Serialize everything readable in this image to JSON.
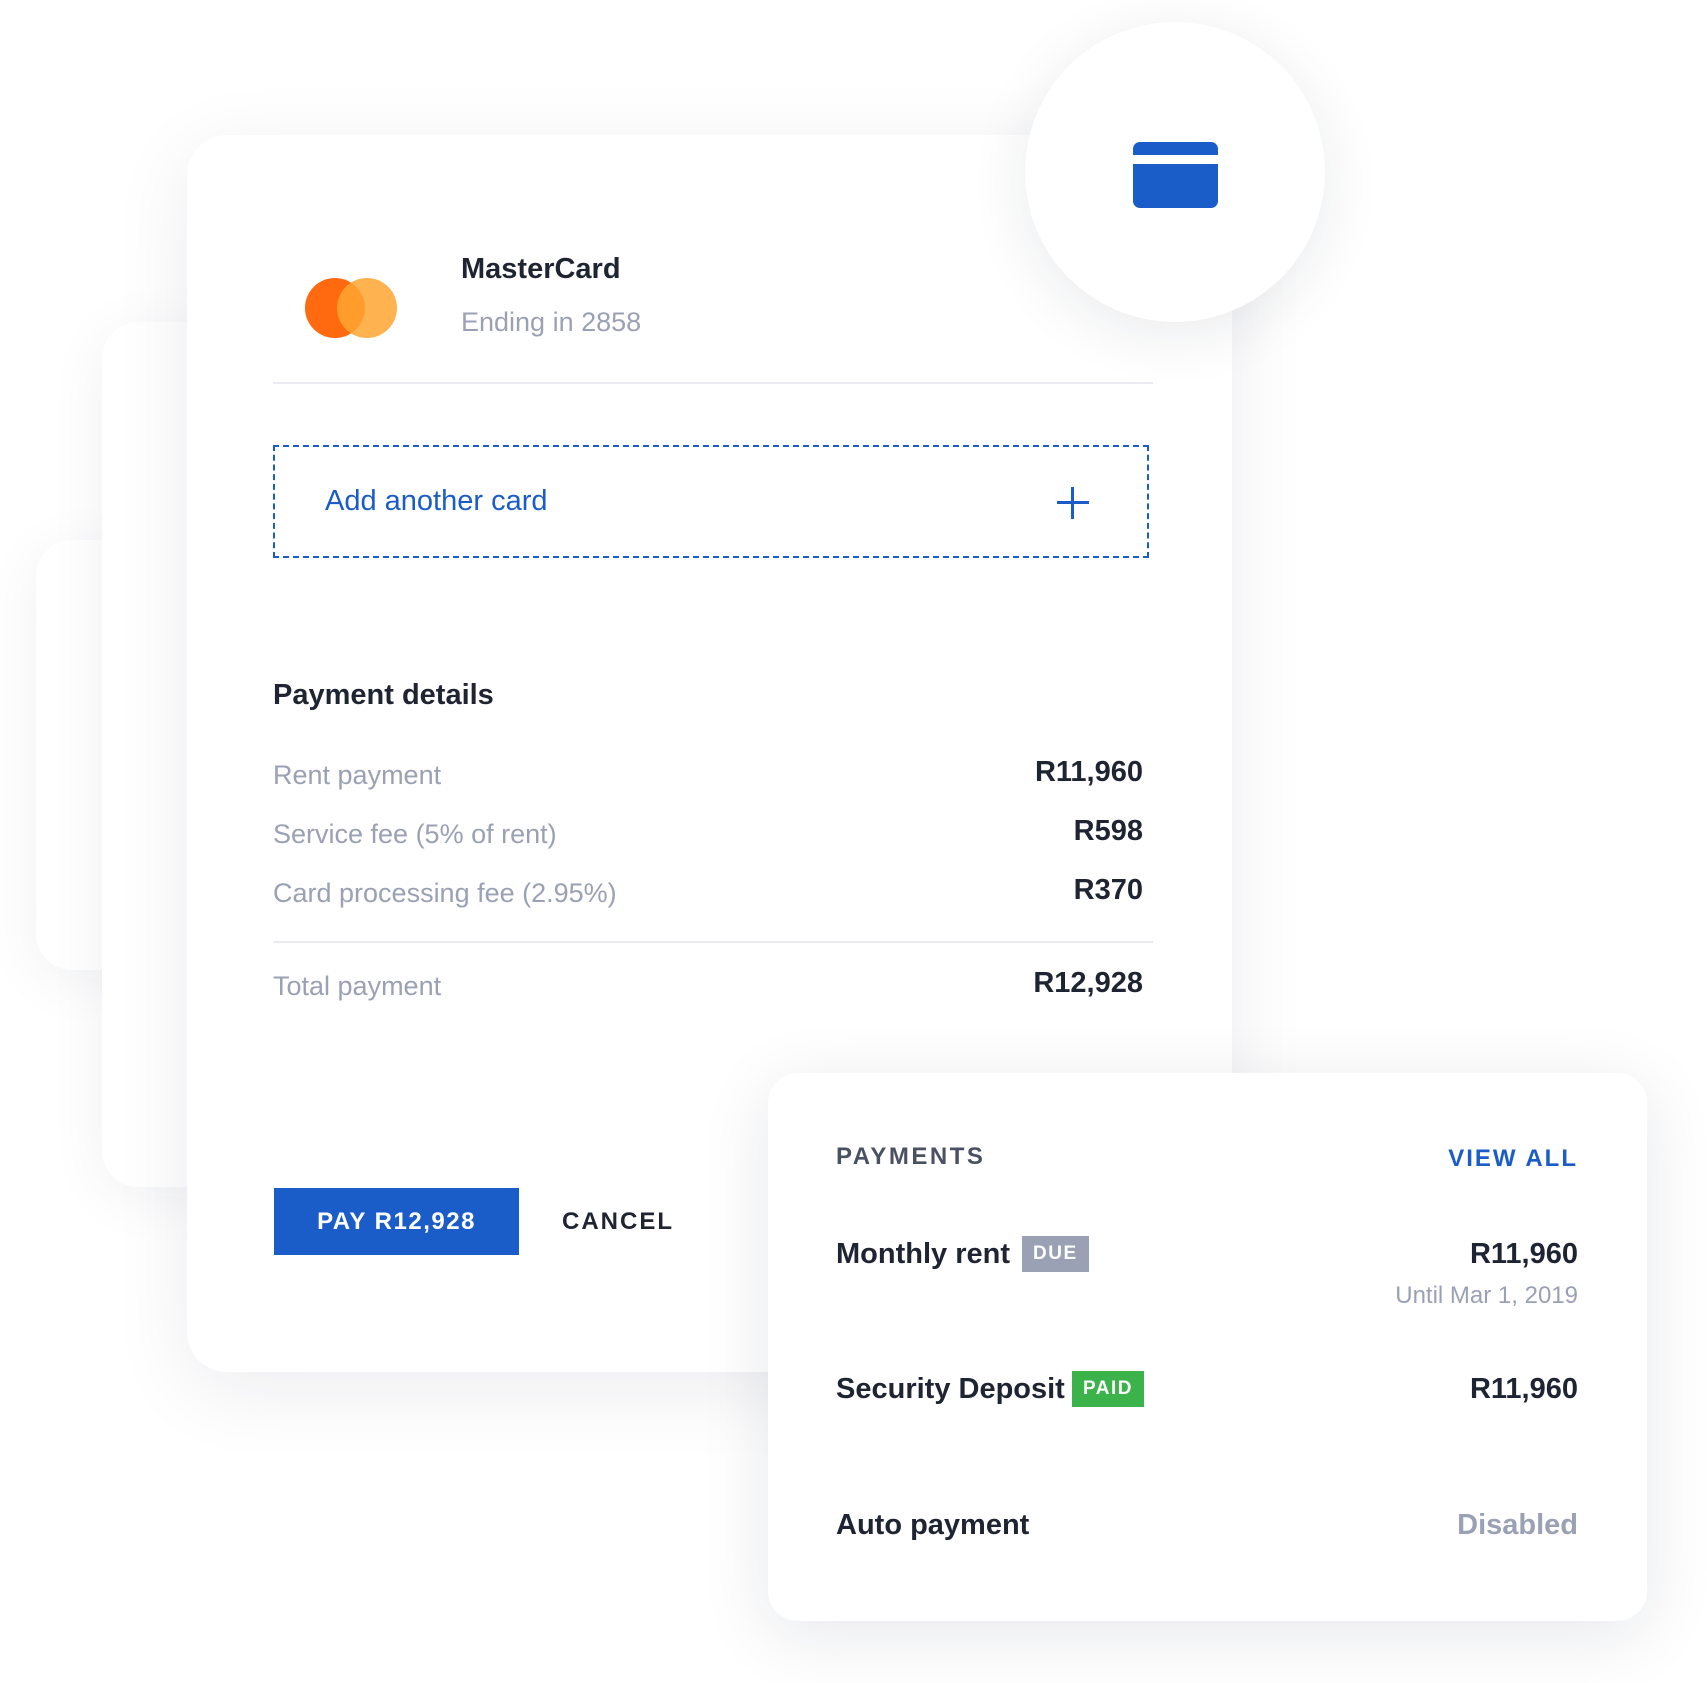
{
  "colors": {
    "accent": "#1a5cc8",
    "text_primary": "#1f2433",
    "text_muted": "#9aa1b4",
    "badge_due": "#9aa1b4",
    "badge_paid": "#3cb34a",
    "mastercard_red": "#ff6a10",
    "mastercard_yellow": "#ffa531"
  },
  "card": {
    "brand": "MasterCard",
    "ending": "Ending in 2858",
    "icon": "mastercard-logo"
  },
  "add_card": {
    "label": "Add another card",
    "icon": "plus-icon"
  },
  "header_icon": "credit-card-icon",
  "payment_details": {
    "title": "Payment details",
    "rows": [
      {
        "label": "Rent payment",
        "value": "R11,960"
      },
      {
        "label": "Service fee (5% of rent)",
        "value": "R598"
      },
      {
        "label": "Card processing fee (2.95%)",
        "value": "R370"
      }
    ],
    "total": {
      "label": "Total payment",
      "value": "R12,928"
    }
  },
  "actions": {
    "pay_label": "PAY R12,928",
    "cancel_label": "CANCEL"
  },
  "payments": {
    "title": "PAYMENTS",
    "view_all": "VIEW ALL",
    "items": [
      {
        "label": "Monthly rent",
        "badge": "DUE",
        "value": "R11,960",
        "sub": "Until Mar 1, 2019"
      },
      {
        "label": "Security Deposit",
        "badge": "PAID",
        "value": "R11,960"
      },
      {
        "label": "Auto payment",
        "value": "Disabled"
      }
    ]
  }
}
